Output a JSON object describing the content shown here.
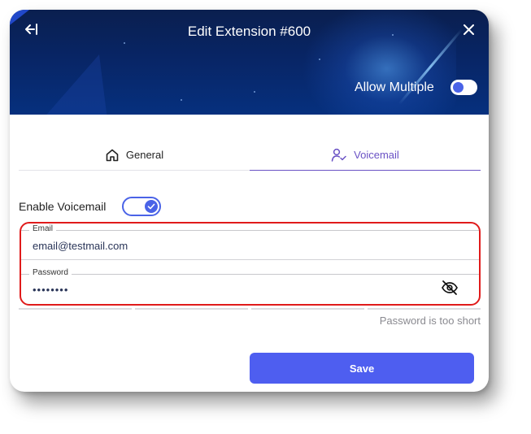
{
  "header": {
    "title": "Edit Extension #600",
    "allow_multiple_label": "Allow Multiple",
    "allow_multiple_enabled": false,
    "back_icon": "back-arrow-icon",
    "close_icon": "close-icon"
  },
  "tabs": [
    {
      "label": "General",
      "icon": "home-icon",
      "active": false
    },
    {
      "label": "Voicemail",
      "icon": "user-check-icon",
      "active": true
    }
  ],
  "voicemail": {
    "enable_label": "Enable Voicemail",
    "enabled": true
  },
  "form": {
    "email_label": "Email",
    "email_value": "email@testmail.com",
    "password_label": "Password",
    "password_value": "••••••••",
    "password_hint": "Password is too short",
    "strength_segments_filled": 0,
    "strength_segments_total": 4
  },
  "actions": {
    "save_label": "Save"
  },
  "colors": {
    "accent": "#4e5ef0",
    "tab_active": "#6a52c5",
    "highlight": "#e01b1b"
  }
}
